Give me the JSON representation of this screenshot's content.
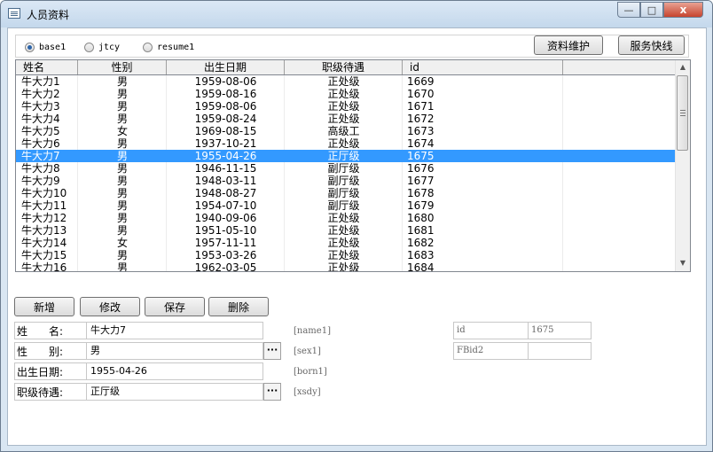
{
  "window": {
    "title": "人员资料",
    "close_glyph": "x",
    "min_glyph": "—",
    "max_glyph": "□"
  },
  "radios": [
    {
      "label": "base1",
      "selected": true
    },
    {
      "label": "jtcy",
      "selected": false
    },
    {
      "label": "resume1",
      "selected": false
    }
  ],
  "top_buttons": {
    "maintain": "资料维护",
    "service": "服务快线"
  },
  "grid": {
    "columns": [
      "姓名",
      "性别",
      "出生日期",
      "职级待遇",
      "id"
    ],
    "selected_index": 6,
    "rows": [
      [
        "牛大力1",
        "男",
        "1959-08-06",
        "正处级",
        "1669"
      ],
      [
        "牛大力2",
        "男",
        "1959-08-16",
        "正处级",
        "1670"
      ],
      [
        "牛大力3",
        "男",
        "1959-08-06",
        "正处级",
        "1671"
      ],
      [
        "牛大力4",
        "男",
        "1959-08-24",
        "正处级",
        "1672"
      ],
      [
        "牛大力5",
        "女",
        "1969-08-15",
        "高级工",
        "1673"
      ],
      [
        "牛大力6",
        "男",
        "1937-10-21",
        "正处级",
        "1674"
      ],
      [
        "牛大力7",
        "男",
        "1955-04-26",
        "正厅级",
        "1675"
      ],
      [
        "牛大力8",
        "男",
        "1946-11-15",
        "副厅级",
        "1676"
      ],
      [
        "牛大力9",
        "男",
        "1948-03-11",
        "副厅级",
        "1677"
      ],
      [
        "牛大力10",
        "男",
        "1948-08-27",
        "副厅级",
        "1678"
      ],
      [
        "牛大力11",
        "男",
        "1954-07-10",
        "副厅级",
        "1679"
      ],
      [
        "牛大力12",
        "男",
        "1940-09-06",
        "正处级",
        "1680"
      ],
      [
        "牛大力13",
        "男",
        "1951-05-10",
        "正处级",
        "1681"
      ],
      [
        "牛大力14",
        "女",
        "1957-11-11",
        "正处级",
        "1682"
      ],
      [
        "牛大力15",
        "男",
        "1953-03-26",
        "正处级",
        "1683"
      ],
      [
        "牛大力16",
        "男",
        "1962-03-05",
        "正处级",
        "1684"
      ]
    ]
  },
  "actions": {
    "add": "新增",
    "edit": "修改",
    "save": "保存",
    "delete": "删除"
  },
  "form": {
    "name_label": "姓　　名:",
    "name_value": "牛大力7",
    "name_tag": "[name1]",
    "sex_label": "性　　别:",
    "sex_value": "男",
    "sex_tag": "[sex1]",
    "born_label": "出生日期:",
    "born_value": "1955-04-26",
    "born_tag": "[born1]",
    "xsdy_label": "职级待遇:",
    "xsdy_value": "正厅级",
    "xsdy_tag": "[xsdy]",
    "ellipsis": "···",
    "id_label": "id",
    "id_value": "1675",
    "fbid_label": "FBid2",
    "fbid_value": ""
  },
  "scrollbar": {
    "up": "▲",
    "down": "▼"
  }
}
